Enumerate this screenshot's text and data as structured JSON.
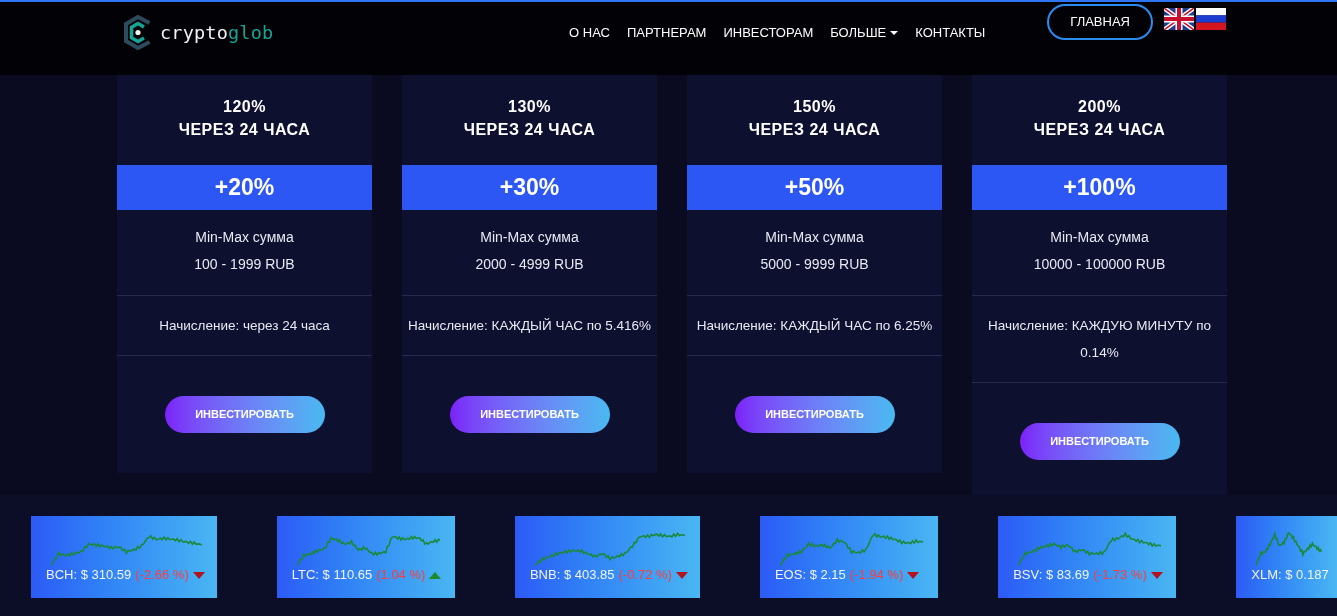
{
  "header": {
    "logo": {
      "text": "crypto",
      "accent": "glob"
    },
    "nav": [
      {
        "label": "О НАС",
        "dropdown": false
      },
      {
        "label": "ПАРТНЕРАМ",
        "dropdown": false
      },
      {
        "label": "ИНВЕСТОРАМ",
        "dropdown": false
      },
      {
        "label": "БОЛЬШЕ",
        "dropdown": true
      },
      {
        "label": "КОНТАКТЫ",
        "dropdown": false
      }
    ],
    "home_button": "ГЛАВНАЯ"
  },
  "plans": [
    {
      "rate": "120%",
      "period": "ЧЕРЕЗ 24 ЧАСА",
      "bonus": "+20%",
      "range_label": "Min-Max сумма",
      "range": "100 - 1999 RUB",
      "accrual": "Начисление: через 24 часа",
      "button": "ИНВЕСТИРОВАТЬ"
    },
    {
      "rate": "130%",
      "period": "ЧЕРЕЗ 24 ЧАСА",
      "bonus": "+30%",
      "range_label": "Min-Max сумма",
      "range": "2000 - 4999 RUB",
      "accrual": "Начисление: КАЖДЫЙ ЧАС по 5.416%",
      "button": "ИНВЕСТИРОВАТЬ"
    },
    {
      "rate": "150%",
      "period": "ЧЕРЕЗ 24 ЧАСА",
      "bonus": "+50%",
      "range_label": "Min-Max сумма",
      "range": "5000 - 9999 RUB",
      "accrual": "Начисление: КАЖДЫЙ ЧАС по 6.25%",
      "button": "ИНВЕСТИРОВАТЬ"
    },
    {
      "rate": "200%",
      "period": "ЧЕРЕЗ 24 ЧАСА",
      "bonus": "+100%",
      "range_label": "Min-Max сумма",
      "range": "10000 - 100000 RUB",
      "accrual": "Начисление: КАЖДУЮ МИНУТУ по 0.14%",
      "button": "ИНВЕСТИРОВАТЬ"
    }
  ],
  "tickers": [
    {
      "kind": "down",
      "price": "BCH: $ 310.59",
      "change": "(-2.66 %)"
    },
    {
      "kind": "up",
      "price": "LTC: $ 110.65",
      "change": "(1.04 %)"
    },
    {
      "kind": "down",
      "price": "BNB: $ 403.85",
      "change": "(-0.72 %)"
    },
    {
      "kind": "down",
      "price": "EOS: $ 2.15",
      "change": "(-1.94 %)"
    },
    {
      "kind": "down",
      "price": "BSV: $ 83.69",
      "change": "(-1.73 %)"
    },
    {
      "price": "XLM: $ 0.187"
    }
  ]
}
